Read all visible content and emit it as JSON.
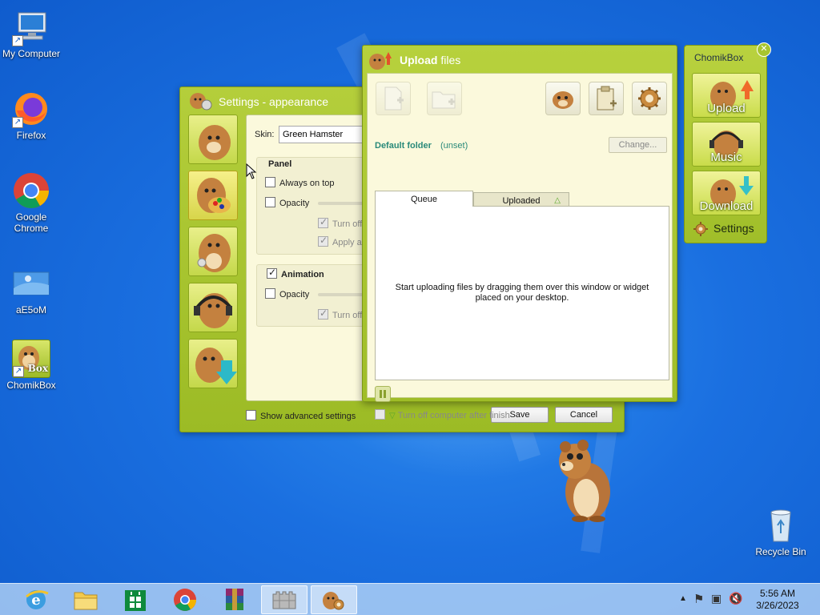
{
  "desktop": {
    "icons": [
      {
        "label": "My Computer",
        "icon": "computer-icon"
      },
      {
        "label": "Firefox",
        "icon": "firefox-icon"
      },
      {
        "label": "Google Chrome",
        "icon": "chrome-icon"
      },
      {
        "label": "aE5oM",
        "icon": "image-file-icon"
      },
      {
        "label": "ChomikBox",
        "icon": "chomikbox-icon",
        "badge": "Box"
      },
      {
        "label": "Recycle Bin",
        "icon": "recycle-bin-icon"
      }
    ]
  },
  "settings": {
    "title": "Settings - appearance",
    "skin_label": "Skin:",
    "skin_value": "Green Hamster",
    "panel_group": "Panel",
    "always_on_top": "Always on top",
    "opacity1": "Opacity",
    "turn_off1": "Turn off",
    "apply_also": "Apply al",
    "animation_group": "Animation",
    "opacity2": "Opacity",
    "turn_off2": "Turn off",
    "show_advanced": "Show advanced settings",
    "save": "Save",
    "cancel": "Cancel"
  },
  "upload": {
    "title_bold": "Upload",
    "title_rest": " files",
    "default_folder": "Default folder",
    "folder_value": "(unset)",
    "change": "Change...",
    "tab_queue": "Queue",
    "tab_uploaded": "Uploaded",
    "empty_line1": "Start uploading files by dragging them over this window or widget",
    "empty_line2": "placed on your desktop.",
    "turn_off_after": "Turn off computer after finish"
  },
  "widget": {
    "title": "ChomikBox",
    "upload": "Upload",
    "music": "Music",
    "download": "Download",
    "settings": "Settings"
  },
  "taskbar": {
    "time": "5:56 AM",
    "date": "3/26/2023",
    "apps": [
      "Internet Explorer",
      "File Explorer",
      "Store",
      "Google Chrome",
      "WinRAR",
      "Castle app",
      "ChomikBox"
    ]
  },
  "colors": {
    "accent_green": "#a3c02a",
    "panel_bg": "#fbf9dc",
    "folder_link": "#2a8a7a"
  }
}
